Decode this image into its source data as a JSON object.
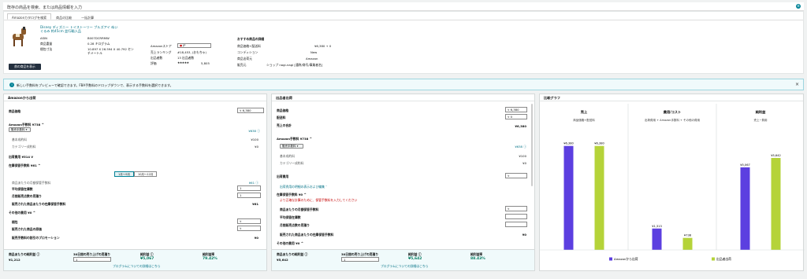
{
  "header": {
    "search_label": "既存の商品を検索、または商品情報を入力"
  },
  "product": {
    "tabs": [
      "Amazonカタログを検索",
      "商品の比較",
      "一括計算"
    ],
    "title": "Disney ディズニー トイストーリー ブルズアイ ぬいぐるみ 約45cm 並行輸入品",
    "asin_label": "ASIN",
    "asin": "B007DCRRMW",
    "weight_label": "商品重量",
    "weight": "0.28 キログラム",
    "dims_label": "梱包寸法",
    "dims": "10.897 X 26.594 X 40.792 センチメートル",
    "store_label": "Amazonストア",
    "store_value": "JP",
    "rank_label": "売上ランキング",
    "rank": "#18,453, (おもちゃ)",
    "sellers_label": "出品者数",
    "sellers": "13 出品者数",
    "rating_label": "評価",
    "stars": "★★★★★",
    "rating_count": "5,805",
    "offer_title": "おすすめ商品の詳細",
    "offer_price_label": "商品価格+配送料",
    "offer_price": "¥6,380 + 0",
    "condition_label": "コンディション",
    "condition": "New",
    "ship_from_label": "商品出荷元",
    "ship_from": "Amazon",
    "seller_label": "販売元",
    "seller": "ショップ nagi-nagi [通称/商号/事業者名]",
    "back_button": "前の商品を表示"
  },
  "info": {
    "text": "新しい手数料をプレビューで確認できます。FBA手数料のドロップダウンで、表示する手数料を選択できます。"
  },
  "amazon": {
    "title": "Amazonから出荷",
    "price_label": "商品価格",
    "price_cur": "¥",
    "price_value": "6,380",
    "fee_label": "Amazon手数料 ¥738",
    "fee_caret": "^",
    "fee_select": "販売手数料",
    "fee_amount": "¥638",
    "base_fee_label": "基本成約料",
    "base_fee": "¥100",
    "cat_fee_label": "カテゴリー成約料",
    "cat_fee": "¥0",
    "ship_label": "出荷費用 ¥514",
    "ship_caret": "v",
    "storage_label": "在庫保管手数料 ¥61",
    "storage_caret": "^",
    "month_toggle": [
      "1月〜9月",
      "10月〜12月"
    ],
    "monthly_fee_label": "商品あたりの月額保管手数料",
    "monthly_fee": "¥61",
    "avg_inv_label": "平均保管在庫数",
    "avg_inv": "1",
    "est_sales_label": "月間販売点数の見積り",
    "est_sales": "1",
    "sold_storage_label": "販売された商品あたりの在庫保管手数料",
    "sold_storage": "¥61",
    "other_label": "その他の費用 ¥0",
    "other_caret": "^",
    "shipping_label": "梱包",
    "shipping_cur": "¥",
    "sold_cost_label": "販売された商品の原価",
    "sold_cost_cur": "¥",
    "promo_label": "販売手数料の割引のプロモーション",
    "promo": "¥0",
    "footer": {
      "profit_label": "商品あたりの純利益",
      "profit": "¥1,212",
      "qty_label": "30日間の売り上げの見積り",
      "qty": "1",
      "net_label": "純利益",
      "net": "¥5,067",
      "margin_label": "純利益率",
      "margin": "79.42%",
      "link": "プログラムについての詳細はこちら"
    }
  },
  "seller": {
    "title": "出品者出荷",
    "price_label": "商品価格",
    "price_cur": "¥",
    "price_value": "6,380",
    "ship_label": "配送料",
    "ship_cur": "¥",
    "ship_value": "0",
    "total_label": "売上の合計",
    "total": "¥6,380",
    "fee_label": "Amazon手数料 ¥738",
    "fee_caret": "^",
    "fee_select": "販売手数料",
    "fee_amount": "¥638",
    "base_fee_label": "基本成約料",
    "base_fee": "¥100",
    "cat_fee_label": "カテゴリー成約料",
    "cat_fee": "¥0",
    "outship_label": "出荷費用",
    "outship_cur": "¥",
    "breakdown_link": "出荷費用の明細の表示および編集",
    "storage_label": "在庫保管手数料 ¥0",
    "storage_caret": "^",
    "storage_warn": "より正確な計算のために、保管手数料を入力してください",
    "monthly_fee_label": "商品あたりの月額保管手数料",
    "monthly_fee_cur": "¥",
    "avg_inv_label": "平均保管在庫数",
    "est_sales_label": "月間販売点数の見積り",
    "sold_storage_label": "販売された商品あたりの在庫保管手数料",
    "sold_storage": "¥0",
    "other_label": "その他の費用 ¥0",
    "other_caret": "^",
    "footer": {
      "profit_label": "商品あたりの純利益",
      "profit": "¥5,642",
      "qty_label": "30日間の売り上げの見積り",
      "qty": "1",
      "net_label": "純利益",
      "net": "¥5,642",
      "margin_label": "純利益率",
      "margin": "88.43%",
      "link": "プログラムについての詳細はこちら"
    }
  },
  "chart_panel": {
    "title": "比較グラフ"
  },
  "chart_data": {
    "type": "bar",
    "groups": [
      {
        "title": "売上",
        "subtitle": "商品価格+配送料"
      },
      {
        "title": "費用/コスト",
        "subtitle": "出荷費用 + Amazon手数料 + その他の費用"
      },
      {
        "title": "純利益",
        "subtitle": "売上−費用"
      }
    ],
    "series": [
      {
        "name": "Amazonから出荷",
        "color": "#5c3fe0",
        "values": [
          6380,
          1313,
          5067
        ],
        "labels": [
          "¥6,380",
          "¥1,313",
          "¥5,067"
        ]
      },
      {
        "name": "出品者出荷",
        "color": "#b5d339",
        "values": [
          6380,
          738,
          5642
        ],
        "labels": [
          "¥6,380",
          "¥738",
          "¥5,642"
        ]
      }
    ],
    "ylim": [
      0,
      6800
    ],
    "legend": "bottom"
  }
}
